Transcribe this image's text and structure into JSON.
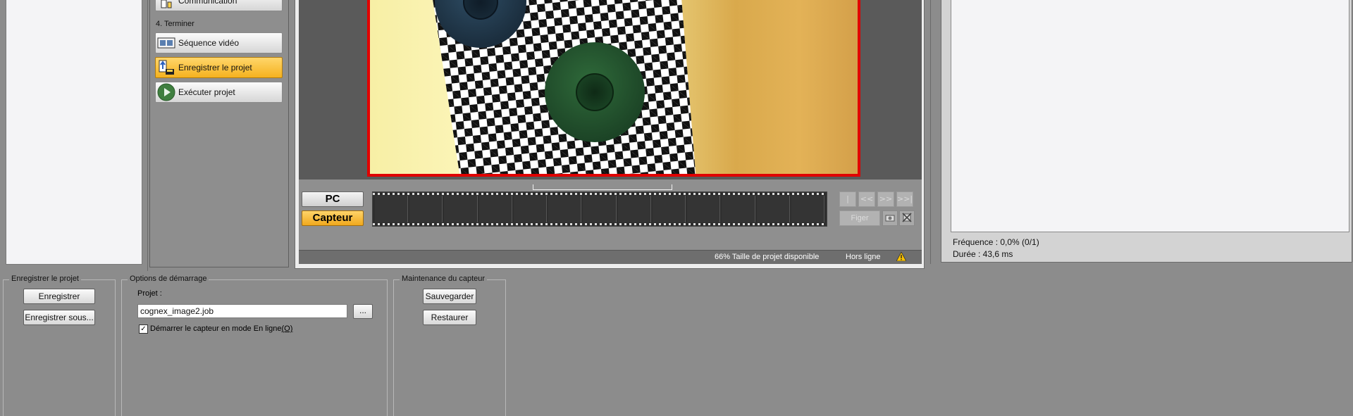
{
  "steps": {
    "partial_button_label": "Communication",
    "section_label": "4. Terminer",
    "items": [
      {
        "label": "Séquence vidéo",
        "icon": "film-sequence-icon"
      },
      {
        "label": "Enregistrer le projet",
        "icon": "save-project-icon",
        "active": true
      },
      {
        "label": "Exécuter projet",
        "icon": "play-icon"
      }
    ]
  },
  "video": {
    "source_pc_label": "PC",
    "source_sensor_label": "Capteur",
    "filmstrip_frame_count": 13,
    "nav_labels": [
      "|<<",
      "<<",
      ">>",
      ">>|"
    ],
    "freeze_label": "Figer",
    "status": {
      "project_size": "66% Taille de projet disponible",
      "connection": "Hors ligne"
    },
    "accent_color": "#f5b21f",
    "border_color": "#e00000"
  },
  "results": {
    "frequency": "Fréquence : 0,0% (0/1)",
    "duration": "Durée : 43,6 ms"
  },
  "save_project_group": {
    "title": "Enregistrer le projet",
    "save_label": "Enregistrer",
    "save_as_label": "Enregistrer sous..."
  },
  "startup_options": {
    "title": "Options de démarrage",
    "project_label": "Projet :",
    "project_value": "cognex_image2.job",
    "browse_label": "...",
    "start_online_label": "Démarrer le capteur en mode En ligne",
    "start_online_shortcut": "(O)",
    "start_online_checked": true
  },
  "maintenance": {
    "title": "Maintenance du capteur",
    "backup_label": "Sauvegarder",
    "restore_label": "Restaurer"
  }
}
